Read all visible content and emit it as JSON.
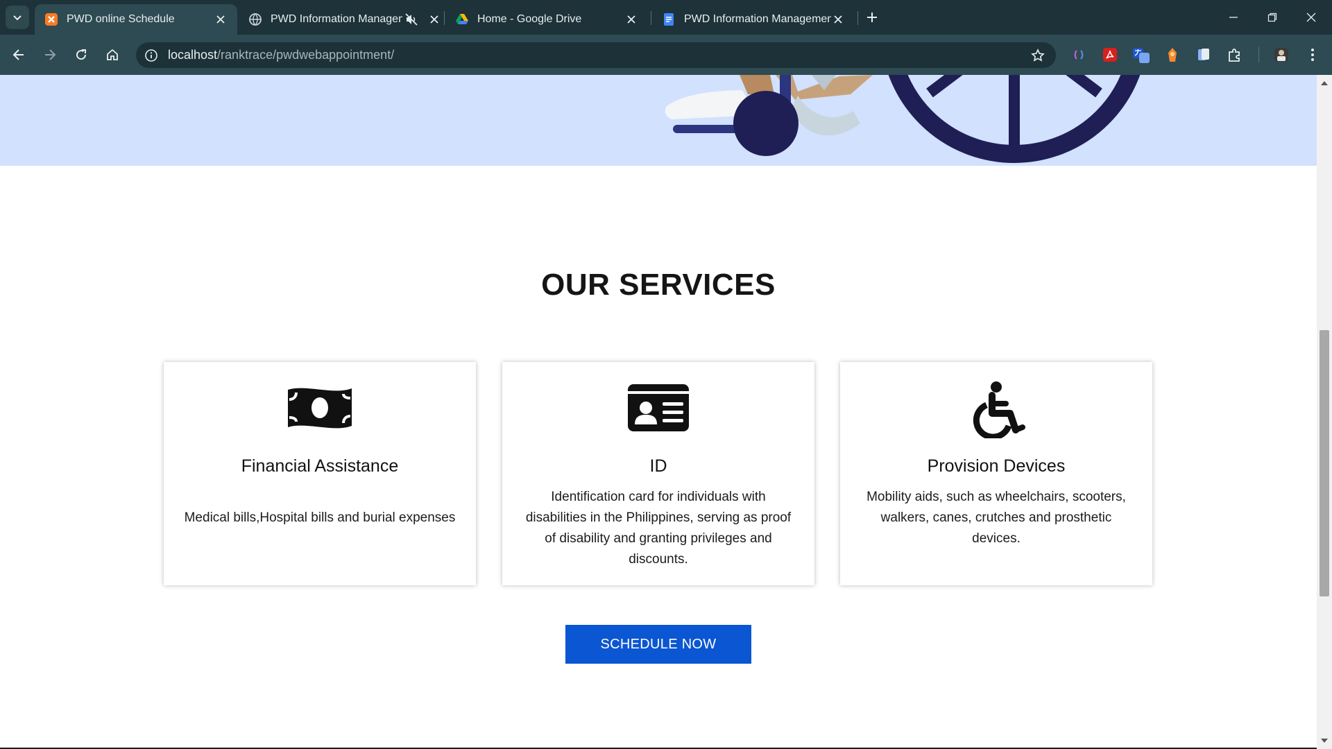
{
  "browser": {
    "tabs": [
      {
        "title": "PWD online Schedule",
        "favicon": "xampp-icon",
        "active": true
      },
      {
        "title": "PWD Information Managem",
        "favicon": "globe-icon",
        "muted": true,
        "active": false
      },
      {
        "title": "Home - Google Drive",
        "favicon": "google-drive-icon",
        "active": false
      },
      {
        "title": "PWD Information Management",
        "favicon": "google-docs-icon",
        "active": false
      }
    ],
    "url_host": "localhost",
    "url_path": "/ranktrace/pwdwebappointment/"
  },
  "page": {
    "section_title": "OUR SERVICES",
    "cards": [
      {
        "title": "Financial Assistance",
        "description": "Medical bills,Hospital bills and burial expenses",
        "icon": "money-bill-icon"
      },
      {
        "title": "ID",
        "description": "Identification card for individuals with disabilities in the Philippines, serving as proof of disability and granting privileges and discounts.",
        "icon": "id-card-icon"
      },
      {
        "title": "Provision Devices",
        "description": "Mobility aids, such as wheelchairs, scooters, walkers, canes, crutches and prosthetic devices.",
        "icon": "wheelchair-icon"
      }
    ],
    "cta_label": "SCHEDULE NOW"
  },
  "colors": {
    "chrome_tabbar": "#1d3239",
    "chrome_toolbar": "#2e4a52",
    "hero_background": "#d1e1fe",
    "cta_button": "#0b56d2",
    "illustration_navy": "#1f1f56"
  }
}
